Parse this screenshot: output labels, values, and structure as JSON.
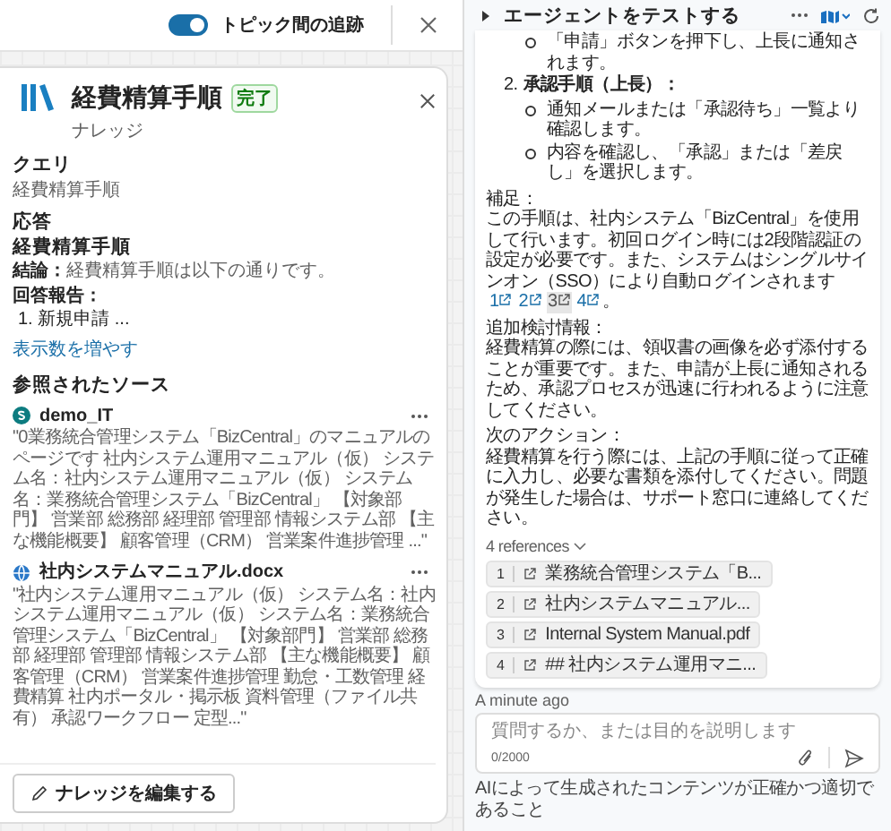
{
  "top_bar": {
    "toggle": {
      "label": "トピック間の追跡",
      "on": true
    }
  },
  "knowledge_card": {
    "title": "経費精算手順",
    "status": "完了",
    "subtitle": "ナレッジ",
    "query_heading": "クエリ",
    "query": "経費精算手順",
    "response_heading": "応答",
    "response_title": "経費精算手順",
    "conclusion_label": "結論：",
    "conclusion": "経費精算手順は以下の通りです。",
    "report_label": "回答報告：",
    "report_items": [
      "1. 新規申請 ..."
    ],
    "show_more": "表示数を増やす",
    "sources_heading": "参照されたソース",
    "sources": [
      {
        "kind": "site",
        "name": "demo_IT",
        "excerpt": "\"0業務統合管理システム「BizCentral」のマニュアルのページです 社内システム運用マニュアル（仮） システム名：社内システム運用マニュアル（仮） システム名：業務統合管理システム「BizCentral」 【対象部門】 営業部 総務部 経理部 管理部 情報システム部 【主な機能概要】 顧客管理（CRM） 営業案件進捗管理 ...\""
      },
      {
        "kind": "web",
        "name": "社内システムマニュアル.docx",
        "excerpt": "\"社内システム運用マニュアル（仮） システム名：社内システム運用マニュアル（仮） システム名：業務統合管理システム「BizCentral」 【対象部門】 営業部 総務部 経理部 管理部 情報システム部 【主な機能概要】 顧客管理（CRM） 営業案件進捗管理 勤怠・工数管理 経費精算 社内ポータル・掲示板 資料管理（ファイル共有） 承認ワークフロー 定型...\""
      }
    ],
    "edit_button": "ナレッジを編集する"
  },
  "test_panel": {
    "title": "エージェントをテストする",
    "message": [
      {
        "kind": "bullet",
        "text": "「申請」ボタンを押下し、上長に通知されます。"
      },
      {
        "kind": "numbered",
        "number": "2.",
        "text": "承認手順（上長）："
      },
      {
        "kind": "bullet",
        "text": "通知メールまたは「承認待ち」一覧より確認します。"
      },
      {
        "kind": "bullet",
        "text": "内容を確認し、「承認」または「差戻し」を選択します。"
      },
      {
        "kind": "paragraph",
        "heading": "補足：",
        "text": "この手順は、社内システム「BizCentral」を使用して行います。初回ログイン時には2段階認証の設定が必要です。また、システムはシングルサインオン（SSO）により自動ログインされます",
        "citations": [
          {
            "label": "1",
            "selected": false
          },
          {
            "label": "2",
            "selected": false
          },
          {
            "label": "3",
            "selected": true
          },
          {
            "label": "4",
            "selected": false
          }
        ],
        "end": "。"
      },
      {
        "kind": "paragraph",
        "heading": "追加検討情報：",
        "text": "経費精算の際には、領収書の画像を必ず添付することが重要です。また、申請が上長に通知されるため、承認プロセスが迅速に行われるように注意してください。"
      },
      {
        "kind": "paragraph",
        "heading": "次のアクション：",
        "text": "経費精算を行う際には、上記の手順に従って正確に入力し、必要な書類を添付してください。問題が発生した場合は、サポート窓口に連絡してください。"
      }
    ],
    "references_label": "4 references",
    "references": [
      {
        "number": "1",
        "title": "業務統合管理システム「B..."
      },
      {
        "number": "2",
        "title": "社内システムマニュアル..."
      },
      {
        "number": "3",
        "title": "Internal System Manual.pdf"
      },
      {
        "number": "4",
        "title": "## 社内システム運用マニ..."
      }
    ],
    "time": "A minute ago",
    "input": {
      "placeholder": "質問するか、または目的を説明します",
      "counter": "0/2000"
    },
    "disclaimer": "AIによって生成されたコンテンツが正確かつ適切であること"
  }
}
